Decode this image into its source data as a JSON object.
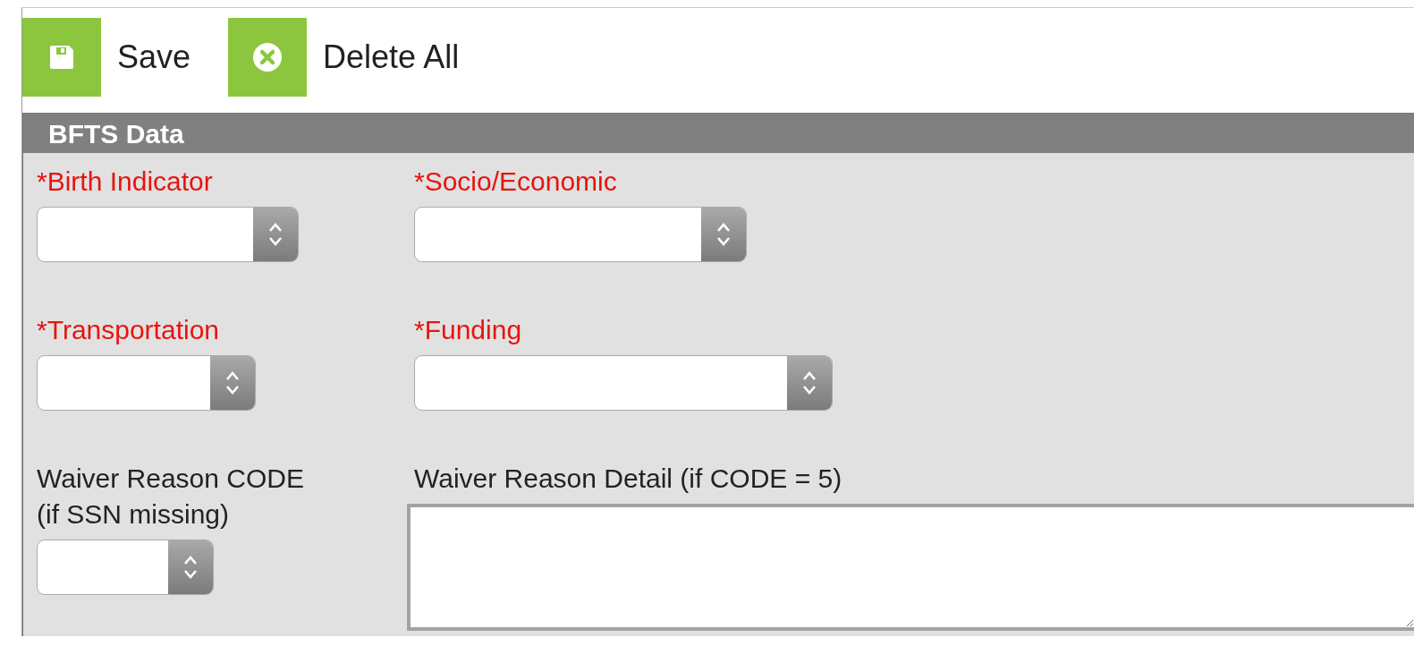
{
  "toolbar": [
    {
      "kind": "save",
      "label": "Save"
    },
    {
      "kind": "delete",
      "label": "Delete All"
    }
  ],
  "panel": {
    "title": "BFTS Data",
    "fields": [
      {
        "kind": "select",
        "label": "*Birth Indicator",
        "required": true
      },
      {
        "kind": "select",
        "label": "*Socio/Economic",
        "required": true
      },
      {
        "kind": "select",
        "label": "*Transportation",
        "required": true
      },
      {
        "kind": "select",
        "label": "*Funding",
        "required": true
      },
      {
        "kind": "select",
        "label": "Waiver Reason CODE (if SSN missing)",
        "required": false
      },
      {
        "kind": "textarea",
        "label": "Waiver Reason Detail (if CODE = 5)",
        "required": false
      }
    ]
  }
}
